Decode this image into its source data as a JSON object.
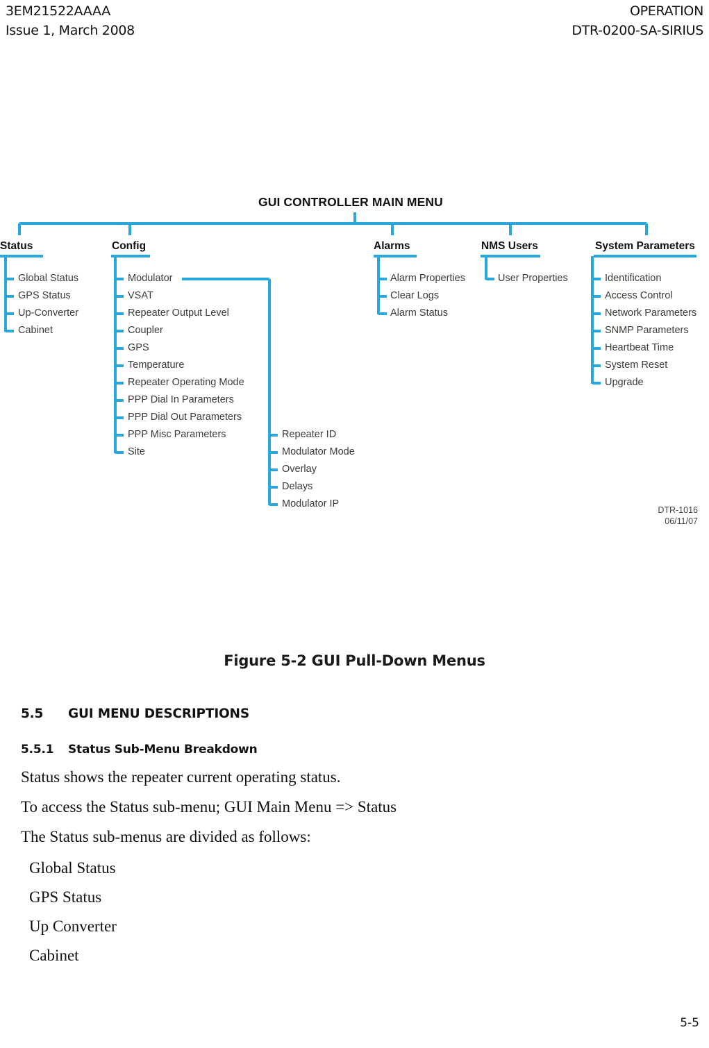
{
  "header": {
    "left_line1": "3EM21522AAAA",
    "left_line2": "Issue 1, March 2008",
    "right_line1": "OPERATION",
    "right_line2": "DTR-0200-SA-SIRIUS"
  },
  "figure": {
    "diagram_title": "GUI CONTROLLER MAIN MENU",
    "caption": "Figure 5-2  GUI Pull-Down Menus",
    "drawing_number": "DTR-1016",
    "drawing_date": "06/11/07",
    "line_color": "#29a8de",
    "categories": [
      {
        "label": "Status",
        "items": [
          "Global Status",
          "GPS Status",
          "Up-Converter",
          "Cabinet"
        ]
      },
      {
        "label": "Config",
        "items": [
          "Modulator",
          "VSAT",
          "Repeater Output Level",
          "Coupler",
          "GPS",
          "Temperature",
          "Repeater Operating Mode",
          "PPP Dial In Parameters",
          "PPP Dial Out Parameters",
          "PPP Misc Parameters",
          "Site"
        ]
      },
      {
        "label": "Alarms",
        "items": [
          "Alarm Properties",
          "Clear Logs",
          "Alarm Status"
        ]
      },
      {
        "label": "NMS Users",
        "items": [
          "User Properties"
        ]
      },
      {
        "label": "System Parameters",
        "items": [
          "Identification",
          "Access Control",
          "Network Parameters",
          "SNMP Parameters",
          "Heartbeat Time",
          "System Reset",
          "Upgrade"
        ]
      }
    ],
    "modulator_submenu": {
      "parent": "Modulator",
      "items": [
        "Repeater ID",
        "Modulator Mode",
        "Overlay",
        "Delays",
        "Modulator IP"
      ]
    }
  },
  "body": {
    "section_number": "5.5",
    "section_title": "GUI MENU DESCRIPTIONS",
    "subsection_number": "5.5.1",
    "subsection_title": "Status Sub-Menu Breakdown",
    "paragraphs": [
      "Status shows the repeater current operating status.",
      "To access the Status sub-menu; GUI Main Menu => Status",
      "The Status sub-menus are divided as follows:"
    ],
    "status_list": [
      "Global Status",
      "GPS Status",
      "Up Converter",
      "Cabinet"
    ]
  },
  "footer": {
    "page_number": "5-5"
  }
}
